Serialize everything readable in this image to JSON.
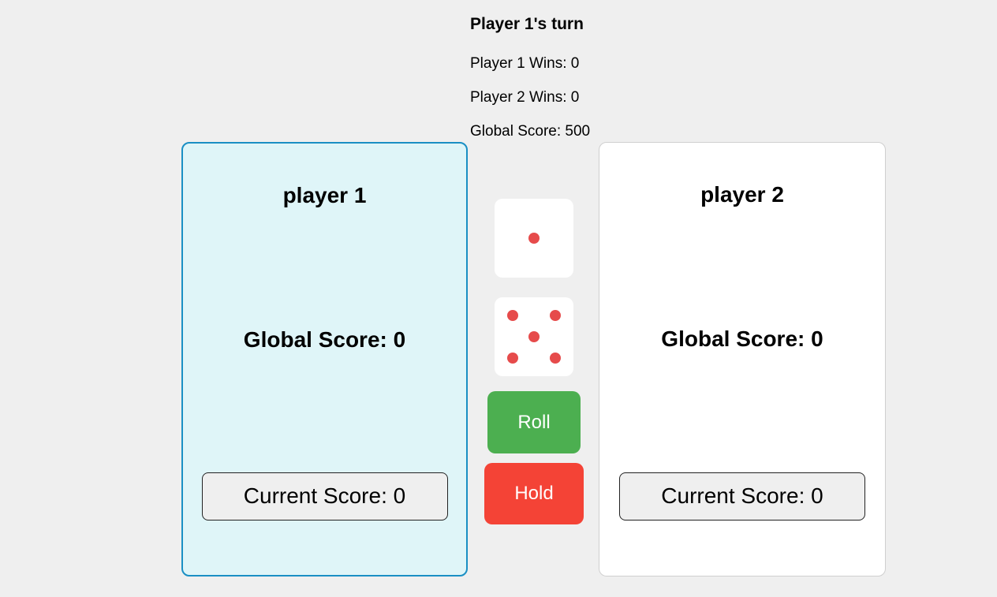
{
  "status": {
    "turn": "Player 1's turn",
    "player1_wins": "Player 1 Wins: 0",
    "player2_wins": "Player 2 Wins: 0",
    "global_score": "Global Score: 500"
  },
  "players": [
    {
      "name": "player 1",
      "global_score": "Global Score: 0",
      "current_score": "Current Score: 0",
      "active": true
    },
    {
      "name": "player 2",
      "global_score": "Global Score: 0",
      "current_score": "Current Score: 0",
      "active": false
    }
  ],
  "dice": [
    {
      "value": 1
    },
    {
      "value": 5
    }
  ],
  "controls": {
    "roll_label": "Roll",
    "hold_label": "Hold"
  },
  "colors": {
    "background": "#efefef",
    "active_panel": "#dff5f8",
    "active_border": "#1a8fc4",
    "inactive_panel": "#ffffff",
    "pip": "#e64b4b",
    "roll_button": "#4caf50",
    "hold_button": "#f44336"
  }
}
